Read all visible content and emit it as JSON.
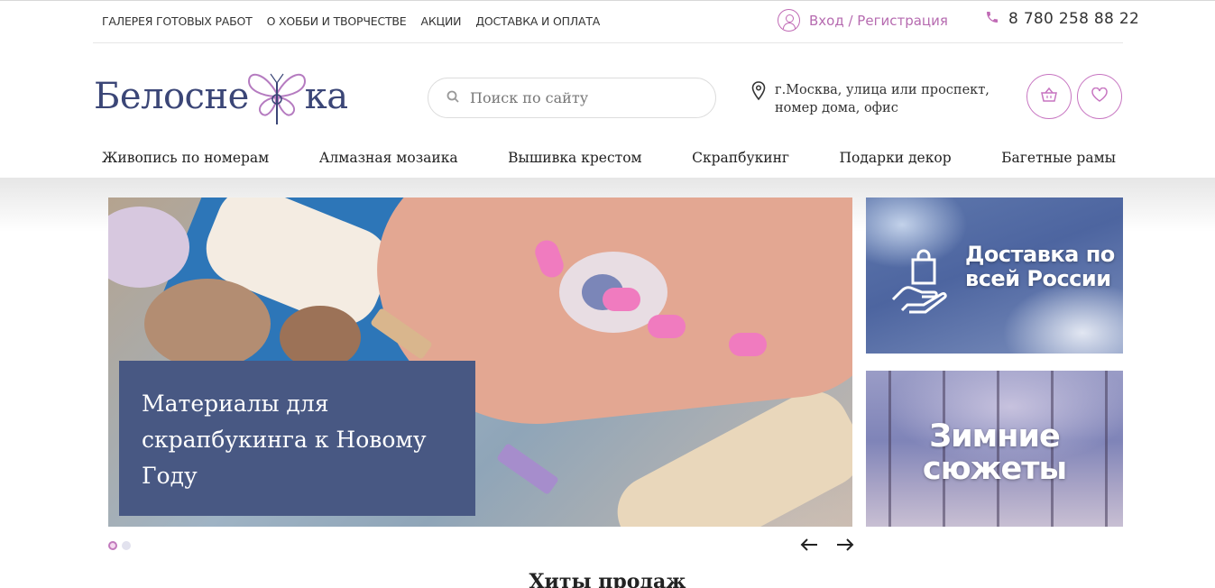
{
  "top_nav": {
    "items": [
      {
        "label": "ГАЛЕРЕЯ ГОТОВЫХ РАБОТ"
      },
      {
        "label": "О ХОББИ И ТВОРЧЕСТВЕ"
      },
      {
        "label": "АКЦИИ"
      },
      {
        "label": "ДОСТАВКА И ОПЛАТА"
      }
    ]
  },
  "account": {
    "login_label": "Вход / Регистрация",
    "icon": "user-icon"
  },
  "contact": {
    "phone": "8 780 258 88 22",
    "icon": "phone-icon"
  },
  "logo": {
    "text_left": "Белосне",
    "text_right": "ка",
    "icon": "butterfly-icon"
  },
  "search": {
    "placeholder": "Поиск по сайту",
    "value": "",
    "icon": "search-icon"
  },
  "address": {
    "line1": "г.Москва, улица или проспект,",
    "line2": "номер дома, офис",
    "icon": "map-pin-icon"
  },
  "header_buttons": {
    "cart_icon": "basket-icon",
    "favorites_icon": "heart-icon"
  },
  "categories": [
    {
      "label": "Живопись по номерам"
    },
    {
      "label": "Алмазная мозаика"
    },
    {
      "label": "Вышивка крестом"
    },
    {
      "label": "Скрапбукинг"
    },
    {
      "label": "Подарки декор"
    },
    {
      "label": "Багетные рамы"
    }
  ],
  "slider": {
    "caption": "Материалы для скрапбукинга к Новому Году",
    "slide_count": 2,
    "active_slide": 1,
    "prev_icon": "arrow-left-icon",
    "next_icon": "arrow-right-icon"
  },
  "banners": [
    {
      "title": "Доставка по всей России",
      "icon": "delivery-hand-icon"
    },
    {
      "title": "Зимние сюжеты"
    }
  ],
  "section": {
    "hits_title": "Хиты продаж"
  },
  "colors": {
    "accent": "#c06ab5",
    "brand_navy": "#3b4677",
    "caption_bg": "#485883"
  }
}
